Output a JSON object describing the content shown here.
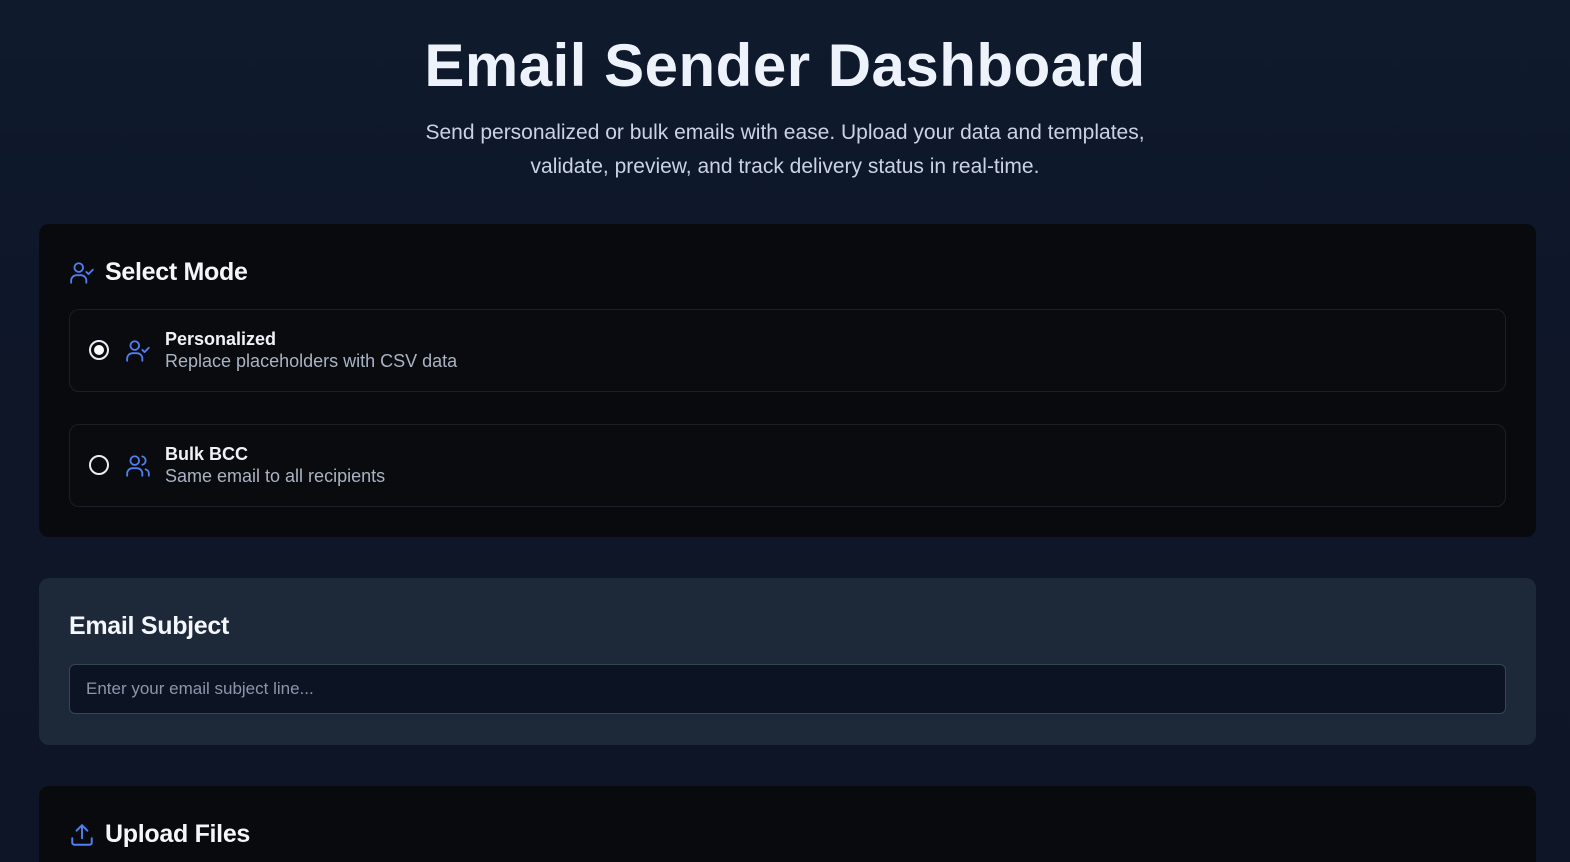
{
  "header": {
    "title": "Email Sender Dashboard",
    "subtitle": "Send personalized or bulk emails with ease. Upload your data and templates, validate, preview, and track delivery status in real-time."
  },
  "mode_section": {
    "title": "Select Mode",
    "icon": "user-check-icon",
    "options": [
      {
        "label": "Personalized",
        "description": "Replace placeholders with CSV data",
        "icon": "user-check-icon",
        "selected": true
      },
      {
        "label": "Bulk BCC",
        "description": "Same email to all recipients",
        "icon": "users-icon",
        "selected": false
      }
    ]
  },
  "subject_section": {
    "title": "Email Subject",
    "value": "",
    "placeholder": "Enter your email subject line..."
  },
  "upload_section": {
    "title": "Upload Files",
    "icon": "upload-icon"
  },
  "colors": {
    "accent": "#4f7ff0",
    "background": "#0f1a2d",
    "card_dark": "#090a0d",
    "card_slate": "#1d2839"
  }
}
